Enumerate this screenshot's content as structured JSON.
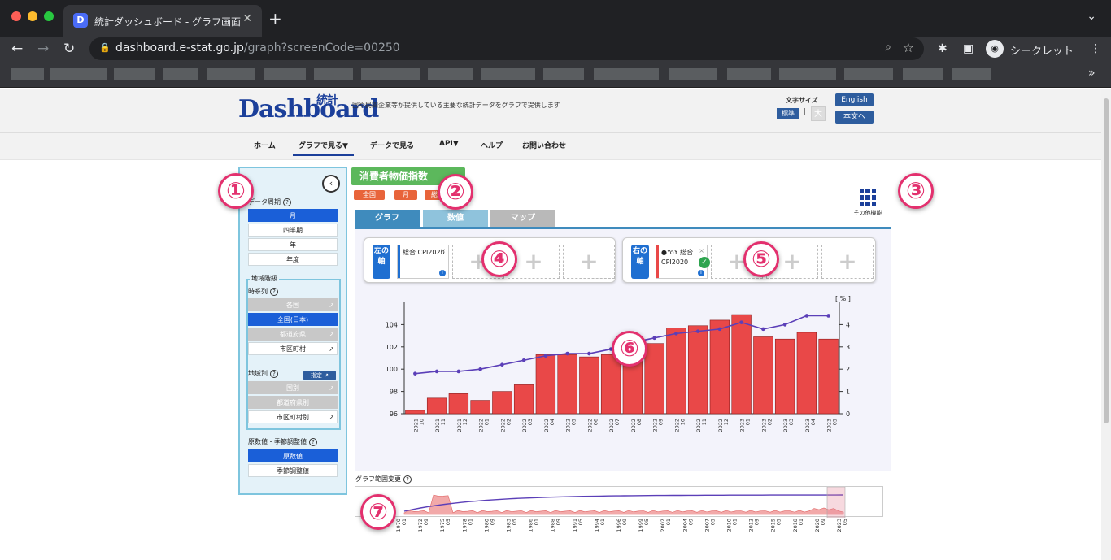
{
  "browser": {
    "tab_title": "統計ダッシュボード - グラフ画面",
    "tab_favicon": "D",
    "url_host": "dashboard.e-stat.go.jp",
    "url_path": "/graph?screenCode=00250",
    "incognito_label": "シークレット",
    "colors": {
      "close": "#ff5f57",
      "minimize": "#febc2e",
      "zoom": "#28c840"
    }
  },
  "header": {
    "logo_text": "Dashboard",
    "logo_kanji": "統計",
    "tagline": "国や民間企業等が提供している主要な統計データをグラフで提供します",
    "font_size_label": "文字サイズ",
    "font_std": "標準",
    "font_sep": "|",
    "font_large": "大",
    "english_btn": "English",
    "body_btn": "本文へ"
  },
  "nav": {
    "items": [
      "ホーム",
      "グラフで見る▼",
      "データで見る",
      "API▼",
      "ヘルプ",
      "お問い合わせ"
    ],
    "active": "グラフで見る▼"
  },
  "left": {
    "collapse_icon": "‹",
    "period_title": "データ周期",
    "periods": [
      "月",
      "四半期",
      "年",
      "年度"
    ],
    "period_selected": "月",
    "region_title": "地域階級",
    "series_title": "時系列",
    "series_opts": [
      "各国",
      "全国(日本)",
      "都道府県",
      "市区町村"
    ],
    "byregion_title": "地域別",
    "designate_btn": "指定",
    "byregion_opts": [
      "国別",
      "都道府県別",
      "市区町村別"
    ],
    "adjust_title": "原数値・季節調整値",
    "adjust_opts": [
      "原数値",
      "季節調整値"
    ],
    "q": "?",
    "ext": "↗"
  },
  "main": {
    "title": "消費者物価指数",
    "tags": [
      "全国",
      "月",
      "総"
    ],
    "other_func": "その他機能",
    "tabs": [
      "グラフ",
      "数値",
      "マップ"
    ],
    "left_axis_label": "左の軸",
    "left_series": "総合 CPI2020",
    "right_axis_label": "右の軸",
    "right_series": "●YoY 総合 CPI2020",
    "slot_plus": "+",
    "slot_close": "×",
    "slot_info": "i",
    "check": "✓",
    "range_label": "グラフ範囲変更",
    "accent_blue": "#1f6fd1",
    "bar_color": "#e94848",
    "line_color": "#5b3fb8"
  },
  "callouts": [
    "①",
    "②",
    "③",
    "④",
    "⑤",
    "⑥",
    "⑦"
  ],
  "chart_data": [
    {
      "type": "bar",
      "categories": [
        "2021 10",
        "2021 11",
        "2021 12",
        "2022 01",
        "2022 02",
        "2022 03",
        "2022 04",
        "2022 05",
        "2022 06",
        "2022 07",
        "2022 08",
        "2022 09",
        "2022 10",
        "2022 11",
        "2022 12",
        "2023 01",
        "2023 02",
        "2023 03",
        "2023 04",
        "2023 05"
      ],
      "series": [
        {
          "name": "総合 CPI2020",
          "axis": "left",
          "type": "bar",
          "values": [
            96.3,
            97.4,
            97.8,
            97.2,
            98.0,
            98.6,
            101.3,
            101.3,
            101.1,
            101.3,
            101.6,
            102.3,
            103.7,
            103.9,
            104.4,
            104.9,
            102.9,
            102.7,
            103.3,
            102.7
          ]
        },
        {
          "name": "YoY 総合 CPI2020",
          "axis": "right",
          "type": "line",
          "values": [
            1.8,
            1.9,
            1.9,
            2.0,
            2.2,
            2.4,
            2.6,
            2.7,
            2.7,
            2.9,
            3.2,
            3.4,
            3.6,
            3.7,
            3.8,
            4.1,
            3.8,
            4.0,
            4.4,
            4.4
          ]
        }
      ],
      "ylim_left": [
        96,
        106
      ],
      "yticks_left": [
        96,
        98,
        100,
        102,
        104
      ],
      "ylim_right": [
        0,
        5
      ],
      "yticks_right": [
        0,
        1,
        2,
        3,
        4
      ],
      "right_unit": "[ % ]"
    },
    {
      "type": "area",
      "categories": [
        "1970 01",
        "1972 09",
        "1975 05",
        "1978 01",
        "1980 09",
        "1983 05",
        "1986 01",
        "1988 09",
        "1991 05",
        "1994 01",
        "1996 09",
        "1999 05",
        "2002 01",
        "2004 09",
        "2007 05",
        "2010 01",
        "2012 09",
        "2015 05",
        "2018 01",
        "2020 09",
        "2023 05"
      ]
    }
  ]
}
